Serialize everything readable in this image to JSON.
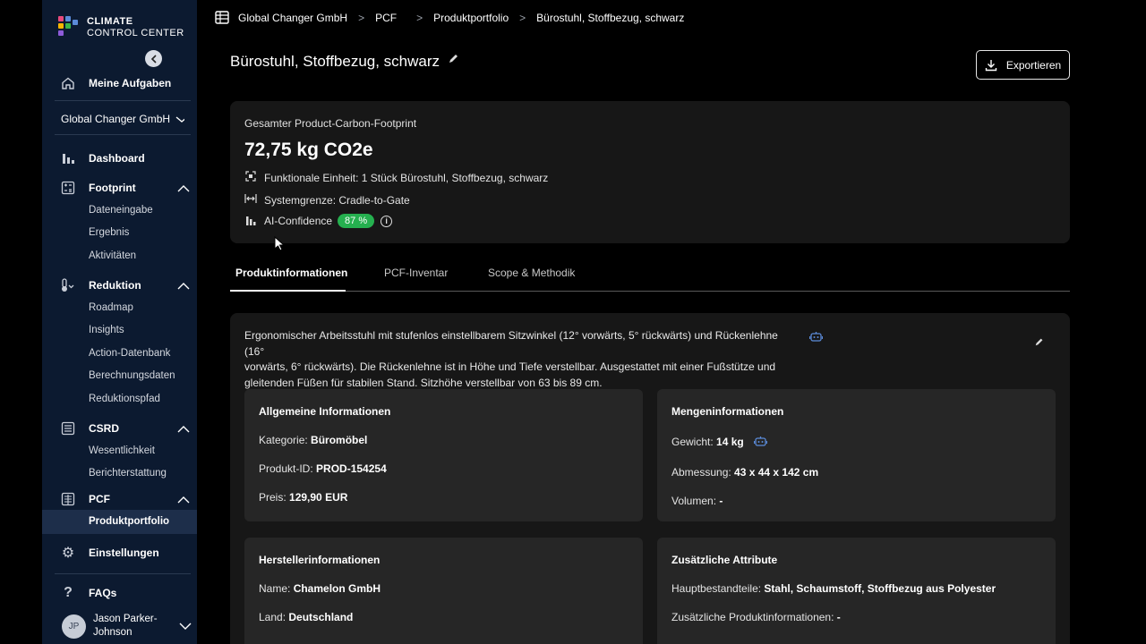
{
  "logo": {
    "line1": "CLIMATE",
    "line2": "CONTROL CENTER",
    "colors": [
      "#e84a7c",
      "#5b8bd9",
      "#39b54a",
      "#f7b500",
      "#8e5bd9"
    ]
  },
  "sidebar": {
    "my_tasks": "Meine Aufgaben",
    "org": "Global Changer GmbH",
    "dashboard": "Dashboard",
    "footprint": {
      "label": "Footprint",
      "items": [
        "Dateneingabe",
        "Ergebnis",
        "Aktivitäten"
      ]
    },
    "reduktion": {
      "label": "Reduktion",
      "items": [
        "Roadmap",
        "Insights",
        "Action-Datenbank",
        "Berechnungsdaten",
        "Reduktionspfad"
      ]
    },
    "csrd": {
      "label": "CSRD",
      "items": [
        "Wesentlichkeit",
        "Berichterstattung"
      ]
    },
    "pcf": {
      "label": "PCF",
      "items": [
        "Produktportfolio"
      ]
    },
    "settings": "Einstellungen",
    "faqs": "FAQs",
    "user": {
      "initials": "JP",
      "name_line1": "Jason Parker-",
      "name_line2": "Johnson"
    }
  },
  "breadcrumb": [
    "Global Changer GmbH",
    "PCF",
    "Produktportfolio",
    "Bürostuhl, Stoffbezug, schwarz"
  ],
  "page": {
    "title": "Bürostuhl, Stoffbezug, schwarz",
    "export_label": "Exportieren"
  },
  "summary": {
    "label": "Gesamter Product-Carbon-Footprint",
    "value": "72,75 kg CO2e",
    "functional_unit": "Funktionale Einheit: 1 Stück Bürostuhl, Stoffbezug, schwarz",
    "system_boundary": "Systemgrenze: Cradle-to-Gate",
    "ai_confidence_label": "AI-Confidence",
    "ai_confidence_value": "87 %"
  },
  "tabs": [
    "Produktinformationen",
    "PCF-Inventar",
    "Scope & Methodik"
  ],
  "description": {
    "line1": "Ergonomischer Arbeitsstuhl mit stufenlos einstellbarem Sitzwinkel (12° vorwärts, 5° rückwärts) und Rückenlehne (16°",
    "line2": "vorwärts, 6° rückwärts). Die Rückenlehne ist in Höhe und Tiefe verstellbar. Ausgestattet mit einer Fußstütze und",
    "line3": "gleitenden Füßen für stabilen Stand. Sitzhöhe verstellbar von 63 bis 89 cm."
  },
  "general": {
    "title": "Allgemeine Informationen",
    "category_label": "Kategorie:",
    "category": "Büromöbel",
    "id_label": "Produkt-ID:",
    "id": "PROD-154254",
    "price_label": "Preis:",
    "price": "129,90 EUR"
  },
  "quantity": {
    "title": "Mengeninformationen",
    "weight_label": "Gewicht:",
    "weight": "14 kg",
    "dimension_label": "Abmessung:",
    "dimension": "43 x 44 x 142 cm",
    "volume_label": "Volumen:",
    "volume": "-"
  },
  "manufacturer": {
    "title": "Herstellerinformationen",
    "name_label": "Name:",
    "name": "Chamelon GmbH",
    "country_label": "Land:",
    "country": "Deutschland"
  },
  "attributes": {
    "title": "Zusätzliche Attribute",
    "components_label": "Hauptbestandteile:",
    "components": "Stahl, Schaumstoff, Stoffbezug aus Polyester",
    "extra_label": "Zusätzliche Produktinformationen:",
    "extra": "-"
  }
}
